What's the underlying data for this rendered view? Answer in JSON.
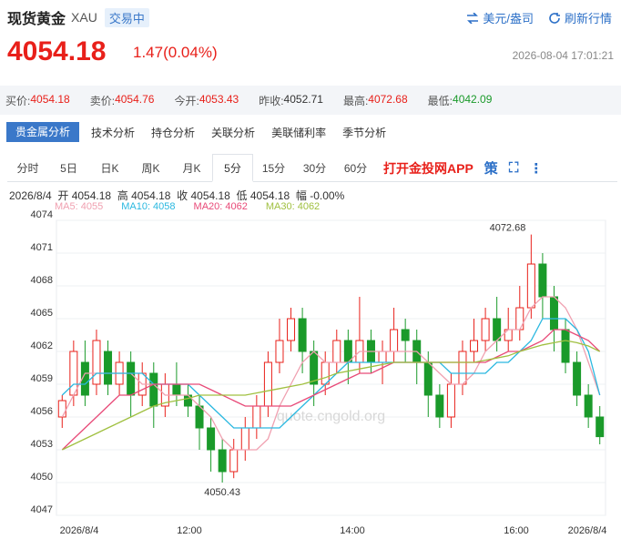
{
  "header": {
    "name": "现货黄金",
    "code": "XAU",
    "status": "交易中",
    "unit_link": "美元/盎司",
    "refresh_link": "刷新行情"
  },
  "price": "4054.18",
  "change": "1.47(0.04%)",
  "datetime": "2026-08-04 17:01:21",
  "quotes": [
    {
      "label": "买价:",
      "value": "4054.18",
      "color": "red"
    },
    {
      "label": "卖价:",
      "value": "4054.76",
      "color": "red"
    },
    {
      "label": "今开:",
      "value": "4053.43",
      "color": "red"
    },
    {
      "label": "昨收:",
      "value": "4052.71",
      "color": "plain"
    },
    {
      "label": "最高:",
      "value": "4072.68",
      "color": "red"
    },
    {
      "label": "最低:",
      "value": "4042.09",
      "color": "grn"
    }
  ],
  "tabs": [
    "贵金属分析",
    "技术分析",
    "持仓分析",
    "关联分析",
    "美联储利率",
    "季节分析"
  ],
  "periods": [
    "分时",
    "5日",
    "日K",
    "周K",
    "月K",
    "5分",
    "15分",
    "30分",
    "60分"
  ],
  "period_active": "5分",
  "app_link": "打开金投网APP",
  "info_line": "2026/8/4  开 4054.18  高 4054.18  收 4054.18  低 4054.18  幅 -0.00%",
  "ma_legend": [
    {
      "text": "MA5: 4055",
      "color": "#f0a0b0"
    },
    {
      "text": "MA10: 4058",
      "color": "#2ab8e0"
    },
    {
      "text": "MA20: 4062",
      "color": "#e84a78"
    },
    {
      "text": "MA30: 4062",
      "color": "#a0c040"
    }
  ],
  "chart_data": {
    "type": "candlestick",
    "ylim": [
      4047,
      4074
    ],
    "yticks": [
      "4074",
      "4071",
      "4068",
      "4065",
      "4062",
      "4059",
      "4056",
      "4053",
      "4050",
      "4047"
    ],
    "xticks": [
      "2026/8/4",
      "12:00",
      "14:00",
      "16:00",
      "2026/8/4"
    ],
    "high_label": "4072.68",
    "low_label": "4050.43",
    "watermark": "quote.cngold.org",
    "candles": [
      [
        4056,
        4057.5,
        4055,
        4058
      ],
      [
        4058,
        4062,
        4057,
        4063
      ],
      [
        4061,
        4058,
        4057,
        4063
      ],
      [
        4059,
        4063,
        4058,
        4064
      ],
      [
        4062,
        4059,
        4058,
        4063
      ],
      [
        4059,
        4061,
        4058,
        4062
      ],
      [
        4061,
        4058,
        4056,
        4062
      ],
      [
        4058,
        4060,
        4057,
        4061
      ],
      [
        4060,
        4057,
        4055,
        4061
      ],
      [
        4057,
        4059,
        4056,
        4060
      ],
      [
        4059,
        4058,
        4057,
        4061
      ],
      [
        4058,
        4057,
        4056,
        4059
      ],
      [
        4057,
        4055,
        4053,
        4058
      ],
      [
        4055,
        4053,
        4051,
        4056
      ],
      [
        4053,
        4051,
        4050,
        4054
      ],
      [
        4051,
        4053,
        4050.4,
        4054
      ],
      [
        4053,
        4055,
        4052,
        4056
      ],
      [
        4055,
        4057,
        4054,
        4058
      ],
      [
        4057,
        4061,
        4056,
        4062
      ],
      [
        4061,
        4063,
        4060,
        4065
      ],
      [
        4063,
        4065,
        4062,
        4066
      ],
      [
        4065,
        4062,
        4060,
        4066
      ],
      [
        4062,
        4059,
        4057,
        4063
      ],
      [
        4059,
        4061,
        4058,
        4062
      ],
      [
        4061,
        4063,
        4060,
        4064
      ],
      [
        4063,
        4061,
        4059,
        4064
      ],
      [
        4061,
        4063,
        4060,
        4067
      ],
      [
        4063,
        4061,
        4060,
        4064
      ],
      [
        4061,
        4062,
        4059,
        4063
      ],
      [
        4062,
        4064,
        4061,
        4066
      ],
      [
        4064,
        4063,
        4061,
        4065
      ],
      [
        4063,
        4061,
        4059,
        4064
      ],
      [
        4061,
        4058,
        4056,
        4062
      ],
      [
        4058,
        4056,
        4055,
        4059
      ],
      [
        4056,
        4059,
        4055,
        4060
      ],
      [
        4059,
        4062,
        4058,
        4063
      ],
      [
        4062,
        4063,
        4061,
        4065
      ],
      [
        4063,
        4065,
        4062,
        4066
      ],
      [
        4065,
        4063,
        4062,
        4067
      ],
      [
        4063,
        4064,
        4062,
        4066
      ],
      [
        4064,
        4066,
        4063,
        4068
      ],
      [
        4066,
        4070,
        4065,
        4072.7
      ],
      [
        4070,
        4067,
        4065,
        4071
      ],
      [
        4067,
        4064,
        4062,
        4068
      ],
      [
        4064,
        4061,
        4060,
        4065
      ],
      [
        4061,
        4058,
        4057,
        4062
      ],
      [
        4058,
        4056,
        4055,
        4059
      ],
      [
        4056,
        4054.2,
        4053.5,
        4057
      ]
    ],
    "series": [
      {
        "name": "MA5",
        "color": "#f0a0b0",
        "values": [
          4056,
          4058,
          4060,
          4060,
          4060,
          4060,
          4060,
          4059,
          4059,
          4058,
          4058,
          4058,
          4057,
          4056,
          4054,
          4053,
          4053,
          4053,
          4054,
          4057,
          4059,
          4061,
          4062,
          4061,
          4061,
          4061,
          4062,
          4062,
          4062,
          4062,
          4062,
          4062,
          4061,
          4060,
          4059,
          4059,
          4060,
          4062,
          4063,
          4064,
          4064,
          4066,
          4067,
          4067,
          4066,
          4064,
          4061,
          4058
        ]
      },
      {
        "name": "MA10",
        "color": "#2ab8e0",
        "values": [
          4058,
          4059,
          4059,
          4060,
          4060,
          4060,
          4060,
          4060,
          4059,
          4059,
          4059,
          4059,
          4058,
          4057,
          4056,
          4055,
          4055,
          4055,
          4055,
          4055,
          4056,
          4057,
          4058,
          4059,
          4060,
          4061,
          4061,
          4061,
          4061,
          4061,
          4061,
          4061,
          4061,
          4061,
          4060,
          4060,
          4060,
          4060,
          4061,
          4061,
          4062,
          4063,
          4065,
          4065,
          4065,
          4064,
          4062,
          4058
        ]
      },
      {
        "name": "MA20",
        "color": "#e84a78",
        "values": [
          4053,
          4054,
          4055,
          4056,
          4057,
          4058,
          4058,
          4058.5,
          4059,
          4059,
          4059,
          4059,
          4059,
          4058.5,
          4058,
          4057.5,
          4057,
          4057,
          4057,
          4057,
          4057,
          4057.5,
          4058,
          4058.5,
          4059,
          4059.5,
          4060,
          4060,
          4060.5,
          4061,
          4061,
          4061,
          4061,
          4061,
          4061,
          4061,
          4061,
          4061,
          4061.5,
          4062,
          4062,
          4062.5,
          4063,
          4064,
          4064,
          4063.5,
          4063,
          4062
        ]
      },
      {
        "name": "MA30",
        "color": "#a0c040",
        "values": [
          4053,
          4053.5,
          4054,
          4054.5,
          4055,
          4055.5,
          4056,
          4056.5,
          4057,
          4057.3,
          4057.5,
          4057.7,
          4058,
          4058,
          4058,
          4058,
          4058,
          4058.2,
          4058.4,
          4058.6,
          4058.8,
          4059,
          4059.3,
          4059.6,
          4060,
          4060.2,
          4060.4,
          4060.6,
          4060.8,
          4061,
          4061,
          4061,
          4061,
          4061,
          4061,
          4061,
          4061,
          4061.2,
          4061.4,
          4061.6,
          4062,
          4062.3,
          4062.6,
          4062.8,
          4063,
          4062.8,
          4062.5,
          4062
        ]
      }
    ]
  }
}
